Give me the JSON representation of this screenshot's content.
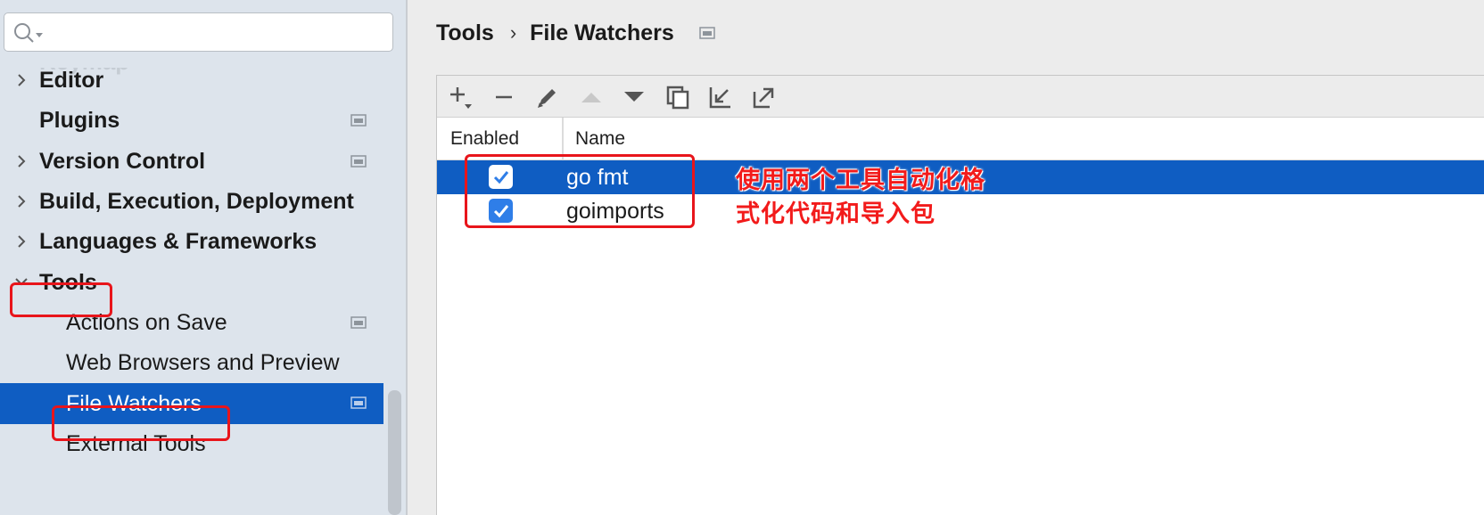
{
  "search": {
    "placeholder": ""
  },
  "sidebar": {
    "faded_item": "Keymap",
    "items": [
      {
        "label": "Editor",
        "level": "top",
        "arrow": "right",
        "project_icon": false
      },
      {
        "label": "Plugins",
        "level": "top",
        "arrow": "none",
        "project_icon": true
      },
      {
        "label": "Version Control",
        "level": "top",
        "arrow": "right",
        "project_icon": true
      },
      {
        "label": "Build, Execution, Deployment",
        "level": "top",
        "arrow": "right",
        "project_icon": false
      },
      {
        "label": "Languages & Frameworks",
        "level": "top",
        "arrow": "right",
        "project_icon": false
      },
      {
        "label": "Tools",
        "level": "top",
        "arrow": "down",
        "project_icon": false
      },
      {
        "label": "Actions on Save",
        "level": "sub",
        "arrow": "none",
        "project_icon": true
      },
      {
        "label": "Web Browsers and Preview",
        "level": "sub",
        "arrow": "none",
        "project_icon": false
      },
      {
        "label": "File Watchers",
        "level": "sub",
        "arrow": "none",
        "project_icon": true,
        "selected": true
      },
      {
        "label": "External Tools",
        "level": "sub",
        "arrow": "none",
        "project_icon": false
      }
    ]
  },
  "breadcrumb": {
    "parent": "Tools",
    "separator": "›",
    "current": "File Watchers"
  },
  "toolbar": {
    "buttons": [
      "add-icon",
      "remove-icon",
      "edit-icon",
      "move-up-icon",
      "move-down-icon",
      "copy-icon",
      "import-icon",
      "export-icon"
    ]
  },
  "table": {
    "columns": [
      "Enabled",
      "Name"
    ],
    "rows": [
      {
        "enabled": true,
        "name": "go fmt",
        "selected": true
      },
      {
        "enabled": true,
        "name": "goimports",
        "selected": false
      }
    ]
  },
  "annotation": {
    "line1": "使用两个工具自动化格",
    "line2": "式化代码和导入包"
  },
  "colors": {
    "selection": "#0f5dc2",
    "checkbox": "#2f7ee8",
    "annotation": "#e8151b",
    "sidebar_bg": "#dde4ec"
  }
}
